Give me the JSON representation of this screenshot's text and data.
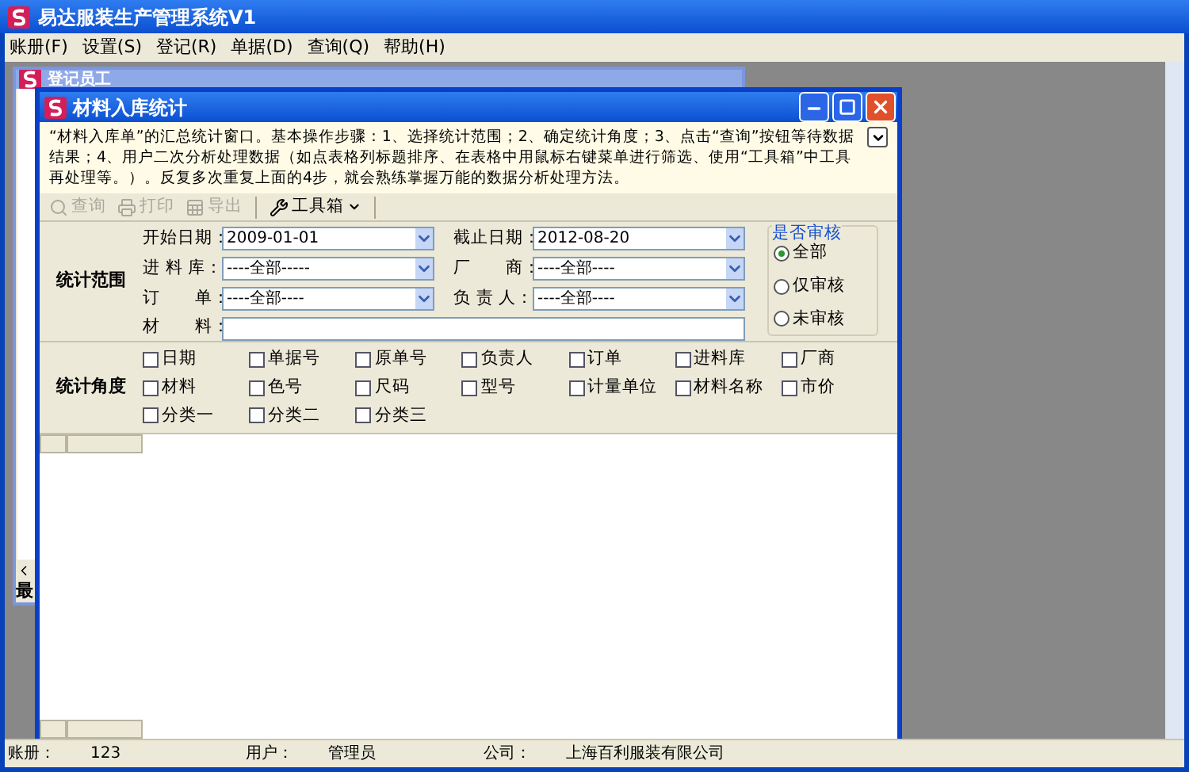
{
  "app_window": {
    "title": "易达服装生产管理系统V1"
  },
  "menu": [
    {
      "label": "账册(F)"
    },
    {
      "label": "设置(S)"
    },
    {
      "label": "登记(R)"
    },
    {
      "label": "单据(D)"
    },
    {
      "label": "查询(Q)"
    },
    {
      "label": "帮助(H)"
    }
  ],
  "background_window": {
    "title": "登记员工",
    "fragment": "最"
  },
  "child_window": {
    "title": "材料入库统计",
    "description": "“材料入库单”的汇总统计窗口。基本操作步骤：1、选择统计范围；2、确定统计角度；3、点击“查询”按钮等待数据结果；4、用户二次分析处理数据（如点表格列标题排序、在表格中用鼠标右键菜单进行筛选、使用“工具箱”中工具再处理等。）。反复多次重复上面的4步，就会熟练掌握万能的数据分析处理方法。",
    "toolbar": [
      {
        "kind": "query",
        "label": "查询",
        "disabled": true
      },
      {
        "kind": "print",
        "label": "打印",
        "disabled": true
      },
      {
        "kind": "export",
        "label": "导出",
        "disabled": true
      },
      {
        "kind": "tools",
        "label": "工具箱",
        "disabled": false
      }
    ],
    "range": {
      "label": "统计范围",
      "fields": [
        {
          "kind": "dropdown",
          "label": "开始日期：",
          "value": "2009-01-01"
        },
        {
          "kind": "dropdown",
          "label": "截止日期：",
          "value": "2012-08-20"
        },
        {
          "kind": "dropdown",
          "label": "进 料 库：",
          "value": "----全部-----"
        },
        {
          "kind": "dropdown",
          "label": "厂　　商：",
          "value": "----全部----"
        },
        {
          "kind": "dropdown",
          "label": "订　　单：",
          "value": "----全部----"
        },
        {
          "kind": "dropdown",
          "label": "负 责 人：",
          "value": "----全部----"
        },
        {
          "kind": "text",
          "label": "材　　料："
        }
      ],
      "audit": {
        "title": "是否审核",
        "options": [
          {
            "label": "全部",
            "selected": true
          },
          {
            "label": "仅审核",
            "selected": false
          },
          {
            "label": "未审核",
            "selected": false
          }
        ]
      }
    },
    "dimensions": {
      "label": "统计角度",
      "options": [
        {
          "label": "日期",
          "checked": false
        },
        {
          "label": "单据号",
          "checked": false
        },
        {
          "label": "原单号",
          "checked": false
        },
        {
          "label": "负责人",
          "checked": false
        },
        {
          "label": "订单",
          "checked": false
        },
        {
          "label": "进料库",
          "checked": false
        },
        {
          "label": "厂商",
          "checked": false
        },
        {
          "label": "材料",
          "checked": false
        },
        {
          "label": "色号",
          "checked": false
        },
        {
          "label": "尺码",
          "checked": false
        },
        {
          "label": "型号",
          "checked": false
        },
        {
          "label": "计量单位",
          "checked": false
        },
        {
          "label": "材料名称",
          "checked": false
        },
        {
          "label": "市价",
          "checked": false
        },
        {
          "label": "分类一",
          "checked": false
        },
        {
          "label": "分类二",
          "checked": false
        },
        {
          "label": "分类三",
          "checked": false
        }
      ]
    }
  },
  "status_bar": [
    {
      "label": "账册：",
      "value": "123"
    },
    {
      "label": "用户：",
      "value": "管理员"
    },
    {
      "label": "公司：",
      "value": "上海百利服装有限公司"
    }
  ]
}
